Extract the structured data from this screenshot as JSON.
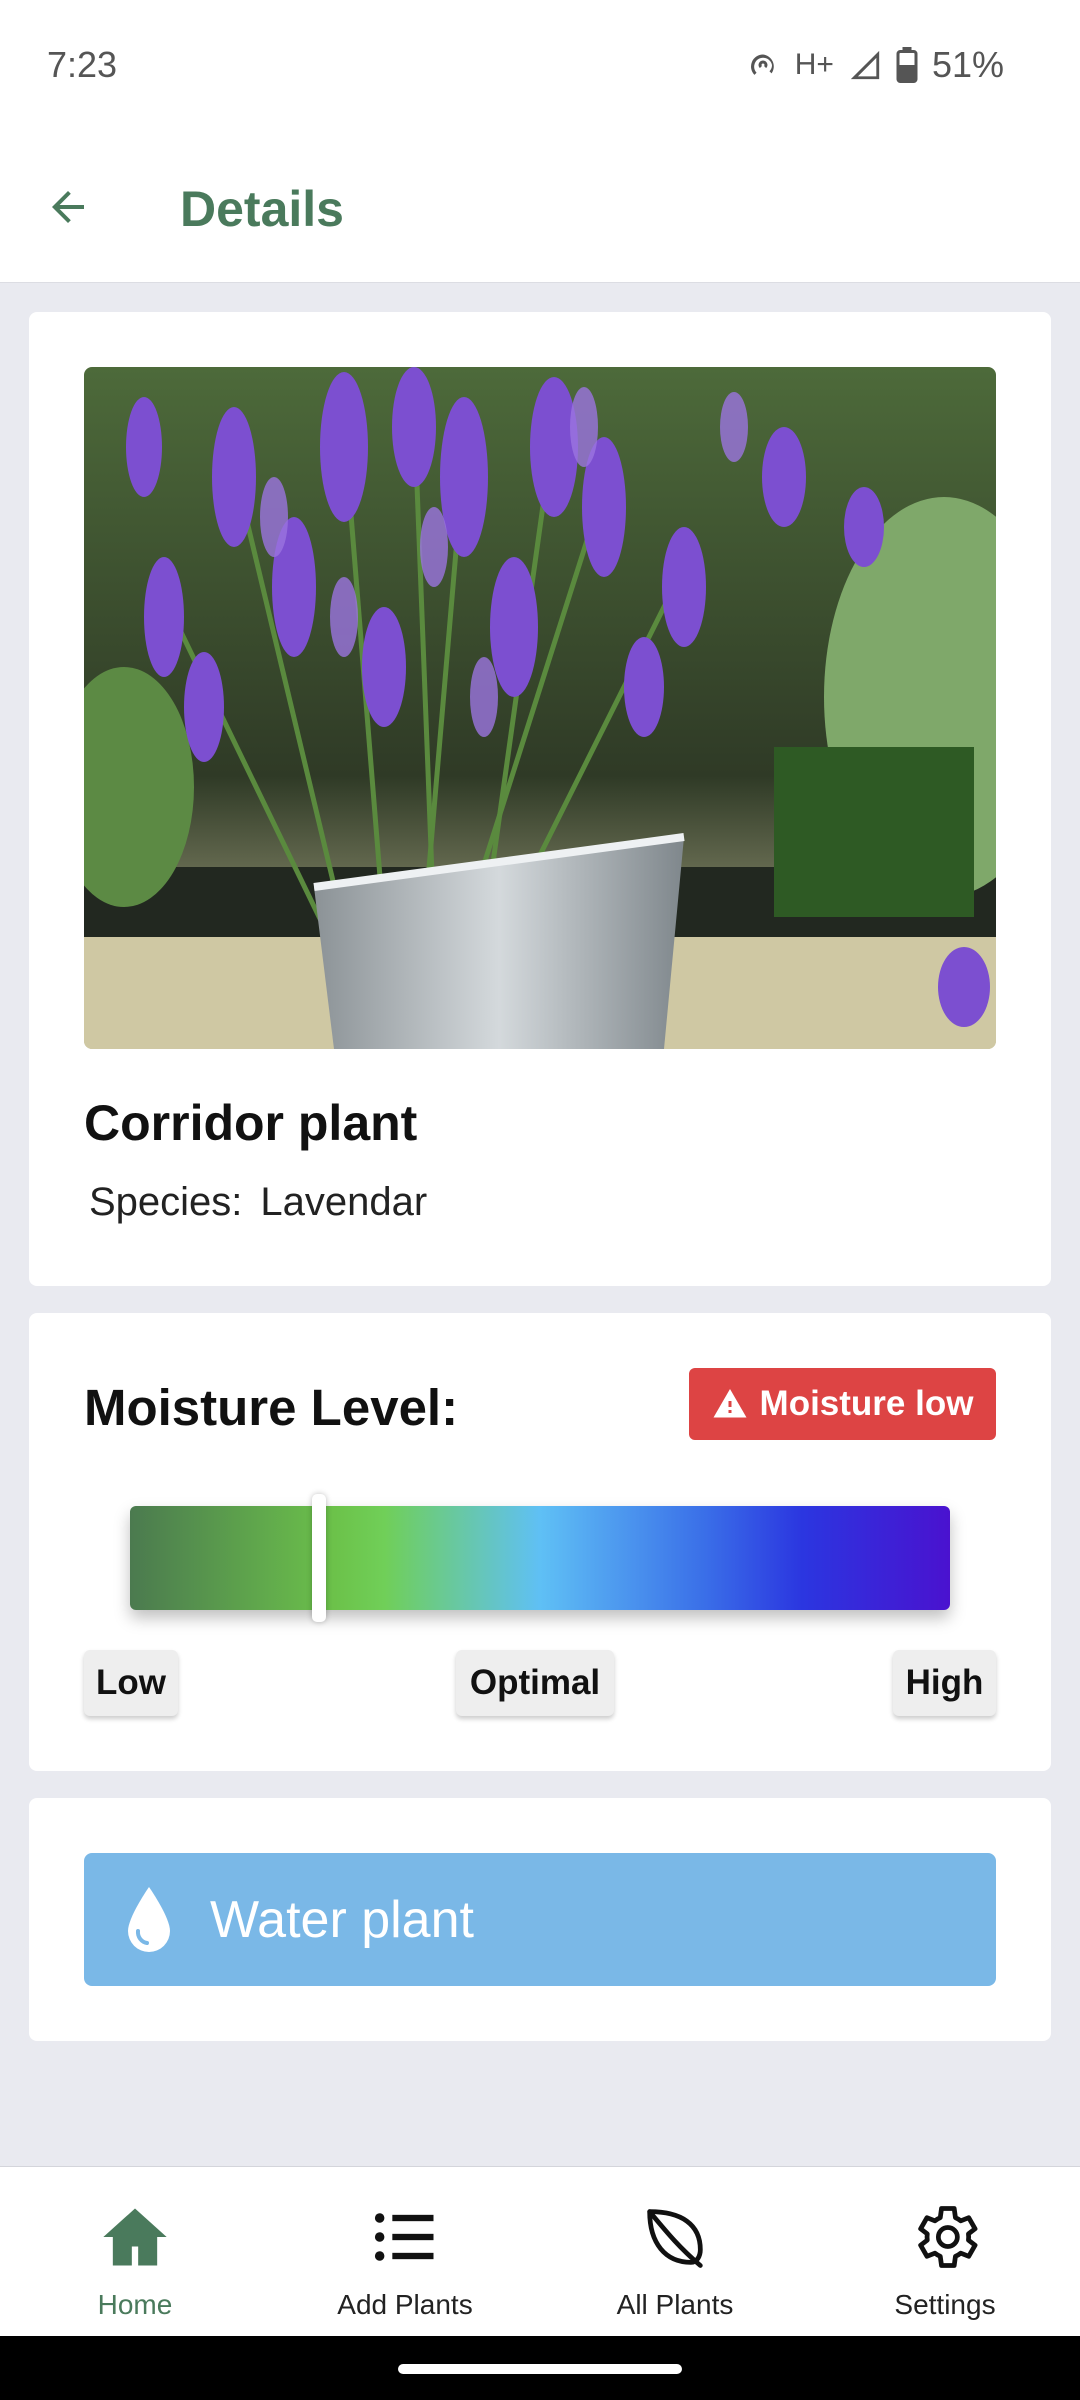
{
  "status_bar": {
    "time": "7:23",
    "network": "H+",
    "battery": "51%"
  },
  "app_bar": {
    "title": "Details"
  },
  "plant": {
    "name": "Corridor plant",
    "species_label": "Species:",
    "species_value": "Lavendar"
  },
  "moisture": {
    "title": "Moisture Level:",
    "badge": "Moisture low",
    "level_fraction": 0.23,
    "label_low": "Low",
    "label_optimal": "Optimal",
    "label_high": "High",
    "colors": {
      "badge": "#dd4444",
      "gradient": [
        "#4b7a4f",
        "#6cc24a",
        "#5fc0f5",
        "#3a6fe8",
        "#4a12cf"
      ]
    }
  },
  "actions": {
    "water_label": "Water plant"
  },
  "bottom_nav": {
    "items": [
      {
        "label": "Home",
        "icon": "home-icon",
        "active": true
      },
      {
        "label": "Add Plants",
        "icon": "list-icon",
        "active": false
      },
      {
        "label": "All Plants",
        "icon": "leaf-icon",
        "active": false
      },
      {
        "label": "Settings",
        "icon": "gear-icon",
        "active": false
      }
    ]
  },
  "theme": {
    "accent": "#4a7a5c",
    "water_button": "#7ab8e7"
  }
}
